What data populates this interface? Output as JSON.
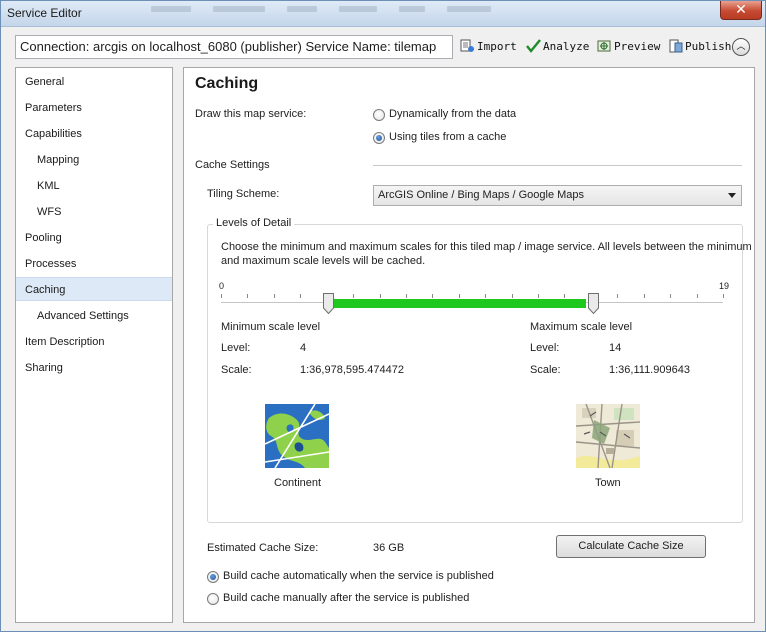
{
  "window": {
    "title": "Service Editor",
    "close_glyph": "✕"
  },
  "toolbar": {
    "connection_text": "Connection: arcgis on localhost_6080 (publisher)   Service Name: tilemap",
    "import_label": "Import",
    "analyze_label": "Analyze",
    "preview_label": "Preview",
    "publish_label": "Publish",
    "collapse_glyph": "︿"
  },
  "sidebar": {
    "items": [
      {
        "label": "General"
      },
      {
        "label": "Parameters"
      },
      {
        "label": "Capabilities"
      },
      {
        "label": "Mapping"
      },
      {
        "label": "KML"
      },
      {
        "label": "WFS"
      },
      {
        "label": "Pooling"
      },
      {
        "label": "Processes"
      },
      {
        "label": "Caching",
        "selected": true
      },
      {
        "label": "Advanced Settings"
      },
      {
        "label": "Item Description"
      },
      {
        "label": "Sharing"
      }
    ]
  },
  "caching": {
    "heading": "Caching",
    "draw_label": "Draw this map service:",
    "draw_option_dynamic": "Dynamically from the data",
    "draw_option_tiles": "Using tiles from a cache",
    "cache_settings_label": "Cache Settings",
    "tiling_scheme_label": "Tiling Scheme:",
    "tiling_scheme_value": "ArcGIS Online / Bing Maps / Google Maps",
    "lod": {
      "legend": "Levels of Detail",
      "description_line1": "Choose the minimum and maximum scales for this tiled map / image service. All levels between the minimum",
      "description_line2": "and maximum scale levels will be cached.",
      "slider_min": "0",
      "slider_max": "19",
      "range_from": 4,
      "range_to": 14,
      "min_title": "Minimum scale level",
      "max_title": "Maximum scale level",
      "level_label": "Level:",
      "scale_label": "Scale:",
      "min_level": "4",
      "min_scale": "1:36,978,595.474472",
      "max_level": "14",
      "max_scale": "1:36,111.909643",
      "min_caption": "Continent",
      "max_caption": "Town"
    },
    "estimated_size_label": "Estimated Cache Size:",
    "estimated_size_value": "36 GB",
    "calculate_button": "Calculate Cache Size",
    "build_auto": "Build cache automatically when the service is published",
    "build_manual": "Build cache manually after the service is published"
  },
  "colors": {
    "slider_range": "#1ec81e",
    "selected_nav": "#dde9f6"
  },
  "icons": [
    "import-icon",
    "analyze-check-icon",
    "preview-icon",
    "publish-icon",
    "chevron-up-icon",
    "close-icon",
    "dropdown-arrow-icon",
    "continent-map-icon",
    "town-map-icon"
  ]
}
